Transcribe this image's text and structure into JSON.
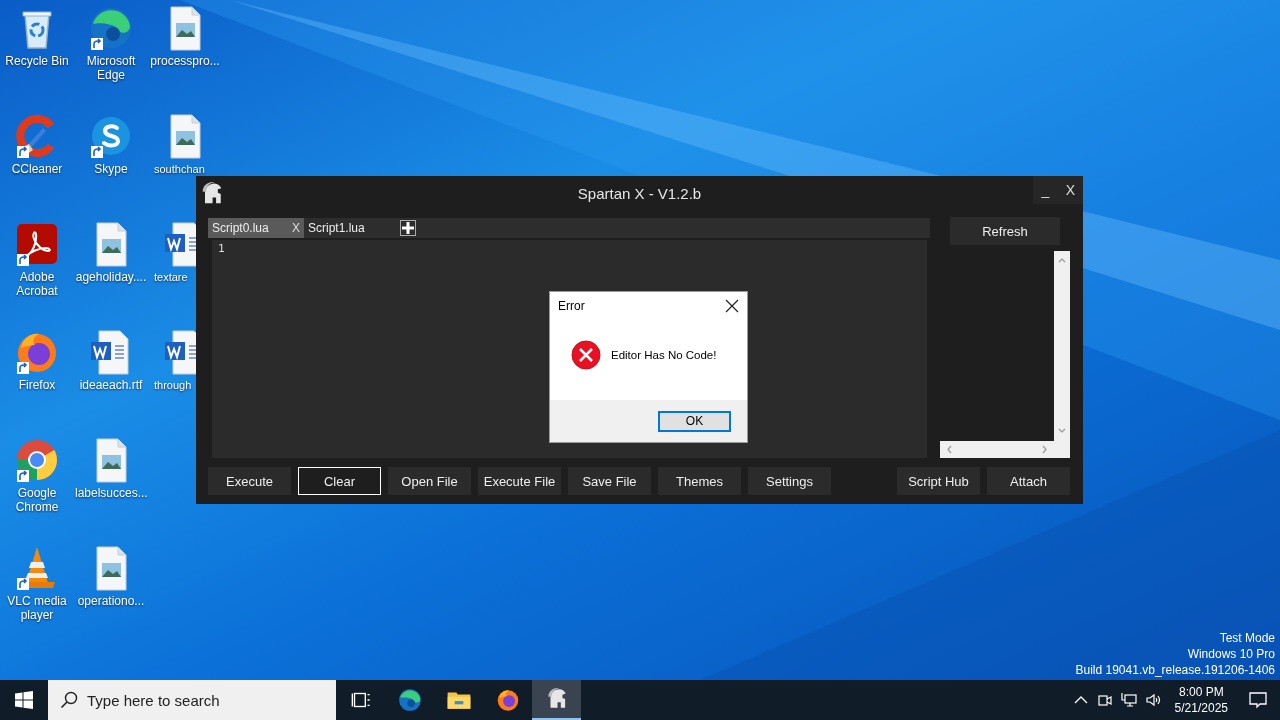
{
  "desktop_icons": [
    {
      "label": "Recycle Bin",
      "kind": "recycle",
      "shortcut": false,
      "cut": false
    },
    {
      "label": "CCleaner",
      "kind": "ccleaner",
      "shortcut": true,
      "cut": false
    },
    {
      "label": "Adobe Acrobat",
      "kind": "pdf",
      "shortcut": true,
      "cut": false
    },
    {
      "label": "Firefox",
      "kind": "firefox",
      "shortcut": true,
      "cut": false
    },
    {
      "label": "Google Chrome",
      "kind": "chrome",
      "shortcut": true,
      "cut": false
    },
    {
      "label": "VLC media player",
      "kind": "vlc",
      "shortcut": true,
      "cut": false
    },
    {
      "label": "Microsoft Edge",
      "kind": "edge",
      "shortcut": true,
      "cut": false
    },
    {
      "label": "Skype",
      "kind": "skype",
      "shortcut": true,
      "cut": false
    },
    {
      "label": "ageholiday....",
      "kind": "image",
      "shortcut": false,
      "cut": false
    },
    {
      "label": "ideaeach.rtf",
      "kind": "word",
      "shortcut": false,
      "cut": false
    },
    {
      "label": "labelsucces...",
      "kind": "image",
      "shortcut": false,
      "cut": false
    },
    {
      "label": "operationo...",
      "kind": "image",
      "shortcut": false,
      "cut": false
    },
    {
      "label": "processpro...",
      "kind": "image",
      "shortcut": false,
      "cut": false
    },
    {
      "label": "southchan",
      "kind": "image",
      "shortcut": false,
      "cut": true
    },
    {
      "label": "textare",
      "kind": "word",
      "shortcut": false,
      "cut": true
    },
    {
      "label": "through",
      "kind": "word",
      "shortcut": false,
      "cut": true
    }
  ],
  "window": {
    "title": "Spartan X - V1.2.b",
    "minimize": "_",
    "close": "X",
    "tabs": [
      {
        "label": "Script0.lua",
        "selected": true,
        "close": "X"
      },
      {
        "label": "Script1.lua",
        "selected": false
      }
    ],
    "editor": {
      "line_numbers": [
        "1"
      ]
    },
    "refresh": "Refresh",
    "buttons": [
      {
        "label": "Execute",
        "focused": false
      },
      {
        "label": "Clear",
        "focused": true
      },
      {
        "label": "Open File",
        "focused": false
      },
      {
        "label": "Execute File",
        "focused": false
      },
      {
        "label": "Save File",
        "focused": false
      },
      {
        "label": "Themes",
        "focused": false
      },
      {
        "label": "Settings",
        "focused": false
      }
    ],
    "right_buttons": [
      {
        "label": "Script Hub",
        "focused": false
      },
      {
        "label": "Attach",
        "focused": false
      }
    ]
  },
  "dialog": {
    "title": "Error",
    "message": "Editor Has No Code!",
    "ok": "OK"
  },
  "system_info": [
    "Test Mode",
    "Windows 10 Pro",
    "Build 19041.vb_release.191206-1406"
  ],
  "taskbar": {
    "search": {
      "placeholder": "Type here to search"
    },
    "apps": [
      {
        "kind": "taskview",
        "active": false
      },
      {
        "kind": "edge",
        "active": false
      },
      {
        "kind": "explorer",
        "active": false
      },
      {
        "kind": "firefox",
        "active": false
      },
      {
        "kind": "spartan",
        "active": true
      }
    ],
    "time": "8:00 PM",
    "date": "5/21/2025"
  }
}
